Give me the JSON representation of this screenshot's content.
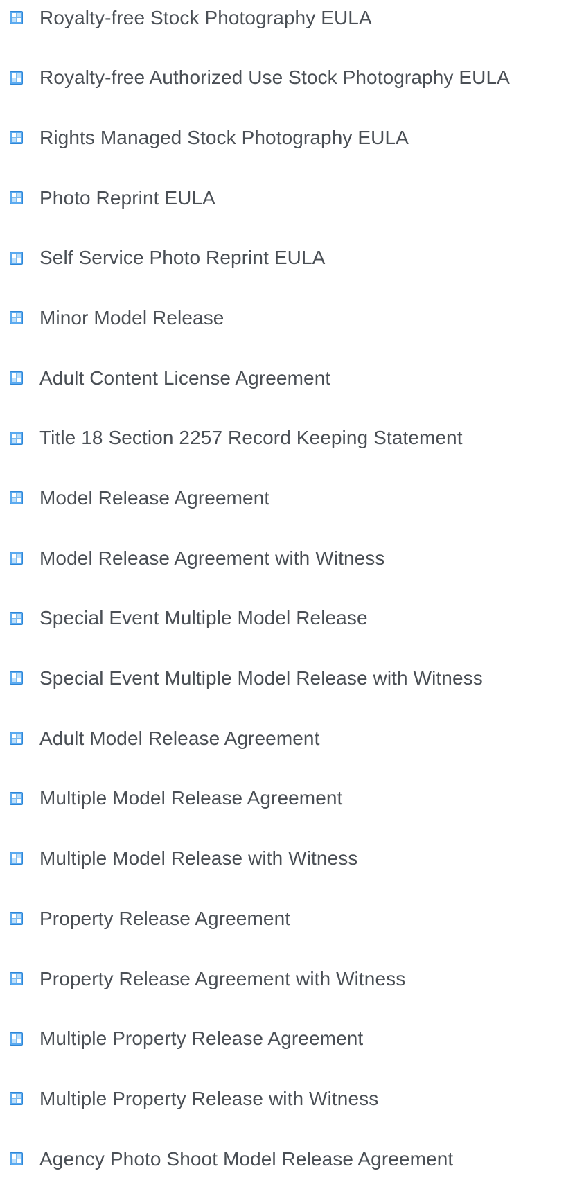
{
  "documents": {
    "items": [
      {
        "label": "Royalty-free Stock Photography EULA",
        "icon": "document-template-icon"
      },
      {
        "label": "Royalty-free Authorized Use Stock Photography EULA",
        "icon": "document-template-icon"
      },
      {
        "label": "Rights Managed Stock Photography EULA",
        "icon": "document-template-icon"
      },
      {
        "label": "Photo Reprint EULA",
        "icon": "document-template-icon"
      },
      {
        "label": "Self Service Photo Reprint EULA",
        "icon": "document-template-icon"
      },
      {
        "label": "Minor Model Release",
        "icon": "document-template-icon"
      },
      {
        "label": "Adult Content License Agreement",
        "icon": "document-template-icon"
      },
      {
        "label": "Title 18 Section 2257 Record Keeping Statement",
        "icon": "document-template-icon"
      },
      {
        "label": "Model Release Agreement",
        "icon": "document-template-icon"
      },
      {
        "label": "Model Release Agreement with Witness",
        "icon": "document-template-icon"
      },
      {
        "label": "Special Event Multiple Model Release",
        "icon": "document-template-icon"
      },
      {
        "label": "Special Event Multiple Model Release with Witness",
        "icon": "document-template-icon"
      },
      {
        "label": "Adult Model Release Agreement",
        "icon": "document-template-icon"
      },
      {
        "label": "Multiple Model Release Agreement",
        "icon": "document-template-icon"
      },
      {
        "label": "Multiple Model Release with Witness",
        "icon": "document-template-icon"
      },
      {
        "label": "Property Release Agreement",
        "icon": "document-template-icon"
      },
      {
        "label": "Property Release Agreement with Witness",
        "icon": "document-template-icon"
      },
      {
        "label": "Multiple Property Release Agreement",
        "icon": "document-template-icon"
      },
      {
        "label": "Multiple Property Release with Witness",
        "icon": "document-template-icon"
      },
      {
        "label": "Agency Photo Shoot Model Release Agreement",
        "icon": "document-template-icon"
      }
    ]
  },
  "colors": {
    "text": "#4a4f55",
    "icon_blue": "#3b9ae1",
    "icon_light": "#cfe7fa"
  }
}
